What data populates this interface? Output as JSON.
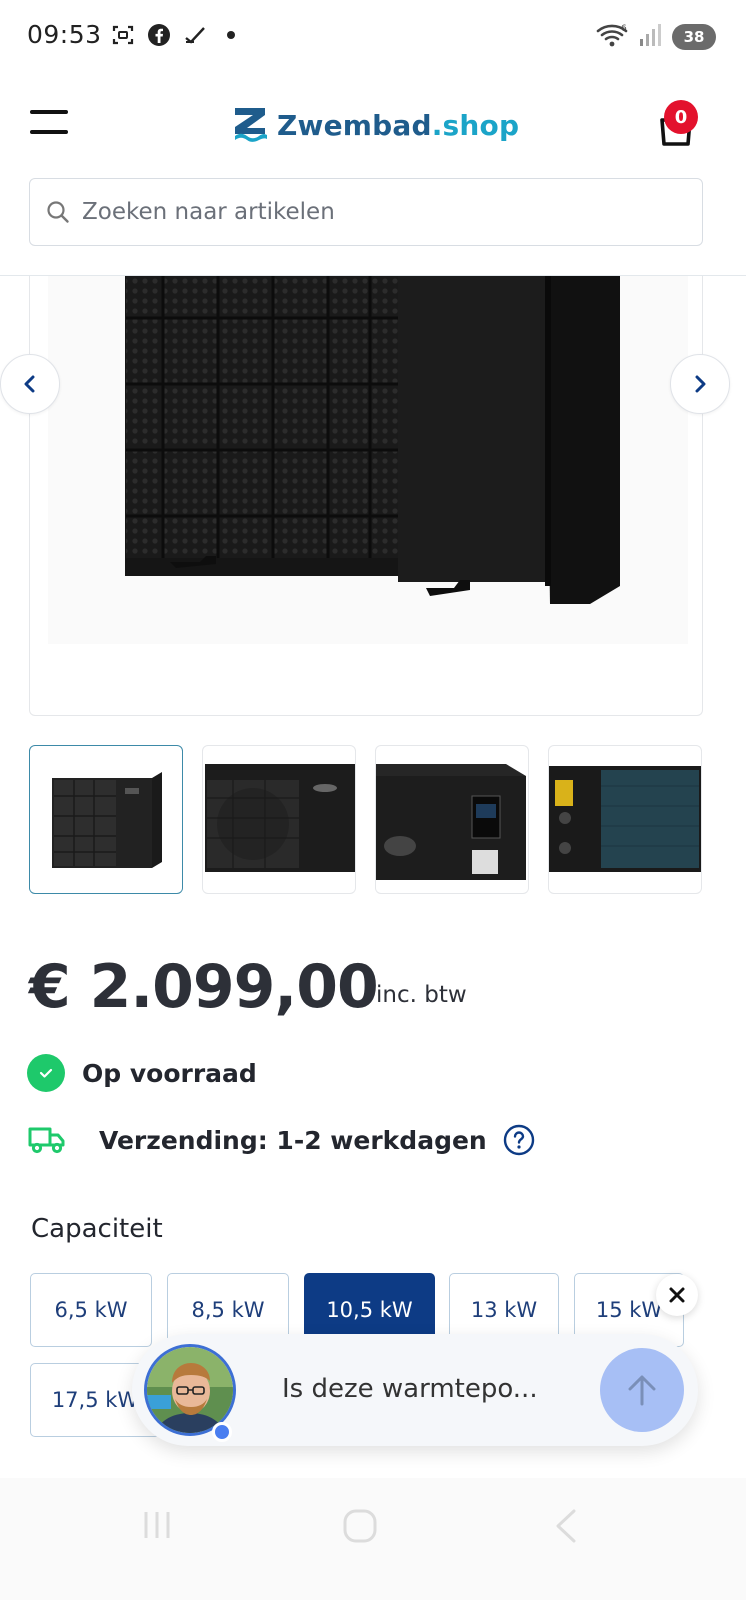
{
  "status_bar": {
    "time": "09:53",
    "battery": "38",
    "icons": [
      "screenshot-icon",
      "facebook-icon",
      "check-icon",
      "dot-icon",
      "wifi-icon",
      "signal-icon"
    ]
  },
  "header": {
    "logo_name": "Zwembad",
    "logo_domain": ".shop",
    "cart_count": "0",
    "brand_colors": {
      "primary": "#1f5c8c",
      "accent": "#1ba4c8"
    }
  },
  "search": {
    "placeholder": "Zoeken naar artikelen",
    "value": ""
  },
  "product": {
    "price": "€ 2.099,00",
    "price_suffix": "inc. btw",
    "stock_label": "Op voorraad",
    "shipping_label": "Verzending: 1-2 werkdagen",
    "capacity_title": "Capaciteit",
    "capacity_options": [
      "6,5 kW",
      "8,5 kW",
      "10,5 kW",
      "13 kW",
      "15 kW",
      "17,5 kW"
    ],
    "selected_capacity": "10,5 kW",
    "thumbnails": [
      "front-view",
      "front-close-view",
      "side-panel-view",
      "back-view"
    ]
  },
  "chat": {
    "message": "Is deze warmtepo..."
  },
  "colors": {
    "selected_option": "#0d3b85",
    "stock_green": "#1ec96b",
    "cart_badge": "#e3122d",
    "chat_send": "#a7bff5"
  }
}
